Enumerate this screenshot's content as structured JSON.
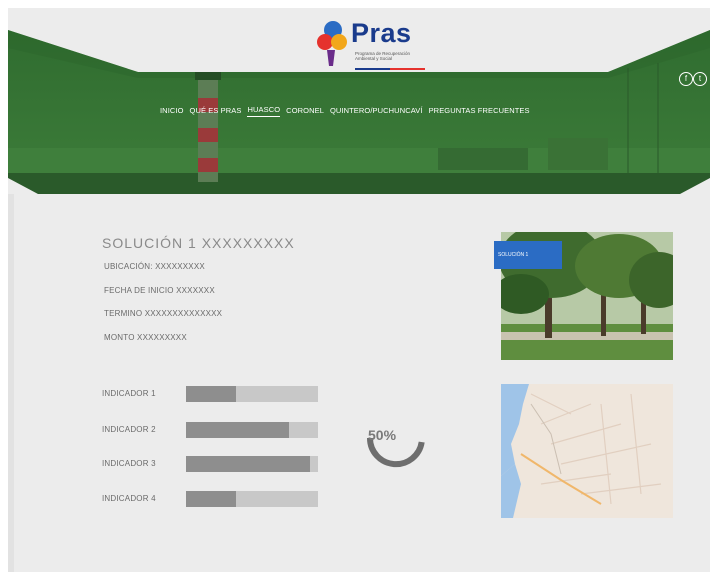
{
  "header": {
    "logo_text": "Pras",
    "logo_subtitle": "Programa de Recuperación Ambiental y Social",
    "nav": [
      {
        "label": "INICIO"
      },
      {
        "label": "QUÉ ES PRAS"
      },
      {
        "label": "HUASCO"
      },
      {
        "label": "CORONEL"
      },
      {
        "label": "QUINTERO/PUCHUNCAVÍ"
      },
      {
        "label": "PREGUNTAS FRECUENTES"
      }
    ],
    "active_nav": "HUASCO",
    "social": [
      {
        "icon": "facebook-icon",
        "glyph": "f"
      },
      {
        "icon": "twitter-icon",
        "glyph": "t"
      }
    ]
  },
  "solution": {
    "title": "SOLUCIÓN 1 XXXXXXXXX",
    "ubicacion": "UBICACIÓN: XXXXXXXXX",
    "fecha_inicio": "FECHA DE INICIO XXXXXXX",
    "termino": "TERMINO XXXXXXXXXXXXXX",
    "monto": "MONTO XXXXXXXXX",
    "photo_tag": "SOLUCIÓN 1"
  },
  "indicators": [
    {
      "label": "INDICADOR 1",
      "level": 0.38
    },
    {
      "label": "INDICADOR 2",
      "level": 0.78
    },
    {
      "label": "INDICADOR 3",
      "level": 0.94
    },
    {
      "label": "INDICADOR 4",
      "level": 0.38
    }
  ],
  "progress": {
    "text": "50%",
    "value": 0.5
  },
  "colors": {
    "header_green": "#2f6e2f",
    "nav_text": "#ffffff",
    "tag_blue": "#2b6cc4",
    "bar_track": "#c8c8c8",
    "bar_fill": "#8e8e8e"
  }
}
